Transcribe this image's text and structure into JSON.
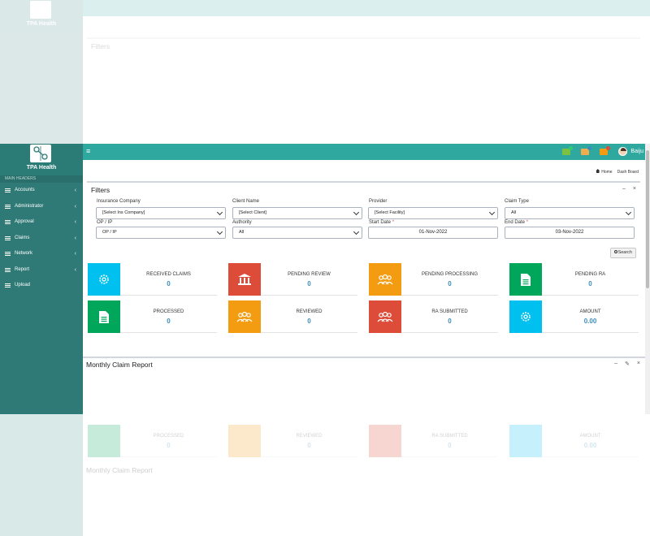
{
  "app": {
    "brand": "TPA Health"
  },
  "topbar": {
    "username": "Baiju",
    "colors": {
      "bar": "#2fa89f",
      "brand": "#2b7b77"
    },
    "notification_icons": [
      {
        "name": "mail-icon",
        "color": "#7dc142",
        "dot": "#2ecc71"
      },
      {
        "name": "flag-icon",
        "color": "#f0ad4e",
        "dot": "#3c8dbc"
      },
      {
        "name": "bell-icon",
        "color": "#f39c12",
        "dot": "#dd4b39"
      }
    ]
  },
  "sidebar": {
    "header": "MAIN HEADERS",
    "items": [
      {
        "label": "Accounts",
        "chevron": "‹"
      },
      {
        "label": "Administrator",
        "chevron": "‹"
      },
      {
        "label": "Approval",
        "chevron": "‹"
      },
      {
        "label": "Claims",
        "chevron": "‹"
      },
      {
        "label": "Network",
        "chevron": "‹"
      },
      {
        "label": "Report",
        "chevron": "‹"
      },
      {
        "label": "Upload",
        "chevron": "‹"
      }
    ]
  },
  "breadcrumb": {
    "home": "Home",
    "current": "Dash Board"
  },
  "filters": {
    "title": "Filters",
    "tools": {
      "collapse": "–",
      "close": "×"
    },
    "insurance_company": {
      "label": "Insurance Company",
      "value": "[Select Ins Company]"
    },
    "client_name": {
      "label": "Client Name",
      "value": "[Select Client]"
    },
    "provider": {
      "label": "Provider",
      "value": "[Select Facility]"
    },
    "claim_type": {
      "label": "Claim Type",
      "value": "All"
    },
    "op_ip": {
      "label": "OP / IP",
      "value": "OP / IP"
    },
    "authority": {
      "label": "Authority",
      "value": "All"
    },
    "start_date": {
      "label": "Start Date",
      "required": "*",
      "value": "01-Nov-2022"
    },
    "end_date": {
      "label": "End Date",
      "required": "*",
      "value": "03-Nov-2022"
    },
    "search_label": "Search"
  },
  "tiles": [
    {
      "title": "RECEIVED CLAIMS",
      "value": "0",
      "color": "#00c0ef",
      "icon": "gear-icon"
    },
    {
      "title": "PENDING REVIEW",
      "value": "0",
      "color": "#dd4b39",
      "icon": "bank-icon"
    },
    {
      "title": "PENDING PROCESSING",
      "value": "0",
      "color": "#f39c12",
      "icon": "users-icon"
    },
    {
      "title": "PENDING RA",
      "value": "0",
      "color": "#00a65a",
      "icon": "document-icon"
    },
    {
      "title": "PROCESSED",
      "value": "0",
      "color": "#00a65a",
      "icon": "document-icon"
    },
    {
      "title": "REVIEWED",
      "value": "0",
      "color": "#f39c12",
      "icon": "users-icon"
    },
    {
      "title": "RA SUBMITTED",
      "value": "0",
      "color": "#dd4b39",
      "icon": "users-icon"
    },
    {
      "title": "AMOUNT",
      "value": "0.00",
      "color": "#00c0ef",
      "icon": "gear-icon"
    }
  ],
  "report": {
    "title": "Monthly Claim Report",
    "tools": {
      "collapse": "–",
      "settings": "✎",
      "close": "×"
    }
  }
}
